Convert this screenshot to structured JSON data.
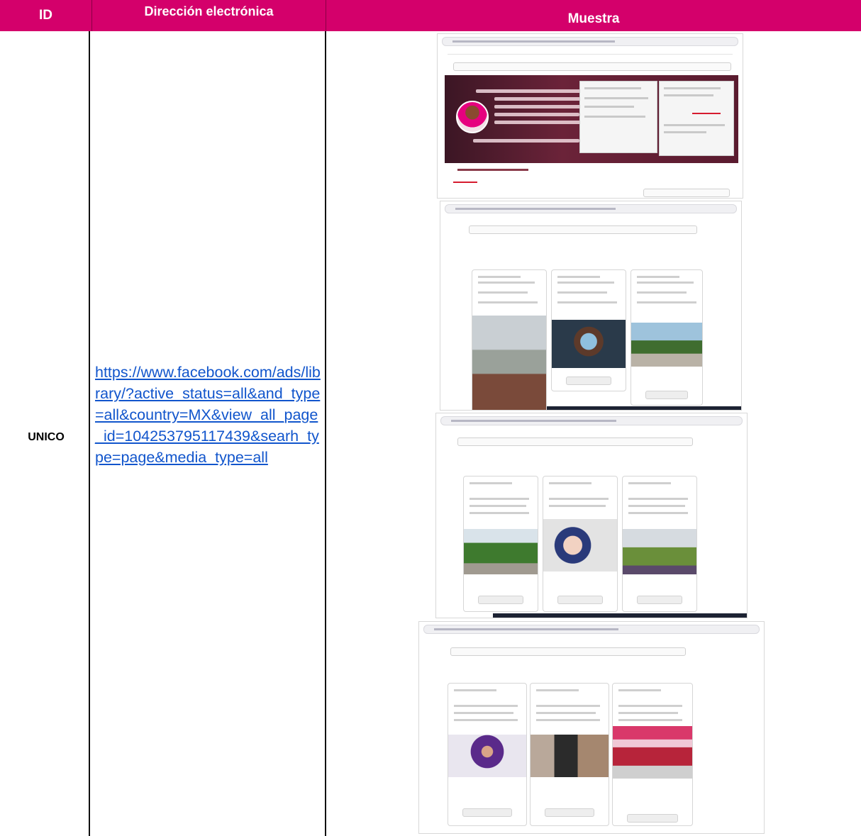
{
  "table": {
    "headers": {
      "id": "ID",
      "direccion": "Dirección electrónica",
      "muestra": "Muestra"
    },
    "row": {
      "id": "UNICO",
      "url": "https://www.facebook.com/ads/library/?active_status=all&and_type=all&country=MX&view_all_page_id=104253795117439&searh_type=page&media_type=all"
    }
  },
  "colors": {
    "header_bg": "#d4006b",
    "header_text": "#ffffff",
    "link": "#1155cc"
  }
}
